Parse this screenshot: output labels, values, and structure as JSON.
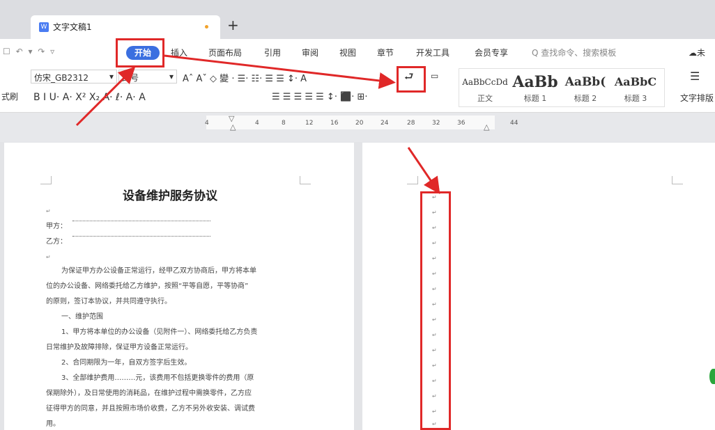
{
  "tabs": {
    "doc_title": "文字文稿1",
    "new_tab": "+"
  },
  "menu": {
    "quick_access": "☐ ↶ ▾ ↷ ▿",
    "items": [
      "开始",
      "插入",
      "页面布局",
      "引用",
      "审阅",
      "视图",
      "章节",
      "开发工具",
      "会员专享"
    ],
    "search": "查找命令、搜索模板",
    "cloud": "未"
  },
  "ribbon": {
    "format_painter": "式刷",
    "font": "仿宋_GB2312",
    "size": "四号",
    "row1_tools": "Aˆ Aˇ ◇ 變 ·  ☰· ☷· ☰ ☰ ↕· A",
    "row2_tools": "B  I  U·  A·  X²  X₂  A·  ℓ·  A·  A",
    "para_tools": "☰ ☰ ☰ ☰ ☰  ↕·  ⬛·  ⊞·",
    "paragraph_mark": "⮐",
    "styles": [
      {
        "preview": "AaBbCcDd",
        "label": "正文"
      },
      {
        "preview": "AaBb",
        "label": "标题 1"
      },
      {
        "preview": "AaBb(",
        "label": "标题 2"
      },
      {
        "preview": "AaBbC",
        "label": "标题 3"
      }
    ],
    "text_layout": "文字排版"
  },
  "ruler": {
    "ticks": [
      "4",
      "4",
      "8",
      "12",
      "16",
      "20",
      "24",
      "28",
      "32",
      "36",
      "44"
    ]
  },
  "document": {
    "heading": "设备维护服务协议",
    "party_a": "甲方：",
    "party_b": "乙方：",
    "lines": [
      "为保证甲方办公设备正常运行，经甲乙双方协商后，甲方将本单",
      "位的办公设备、网络委托给乙方维护，按照“平等自愿，平等协商”",
      "的原则，签订本协议，并共同遵守执行。",
      "一、维护范围",
      "1、甲方将本单位的办公设备（见附件一）、网络委托给乙方负责",
      "日常维护及故障排除，保证甲方设备正常运行。",
      "2、合同期限为一年，自双方签字后生效。",
      "3、全部维护费用………元，该费用不包括更换零件的费用（原",
      "保期除外），及日常使用的消耗品，在维护过程中需换零件，乙方应",
      "征得甲方的同意，并且按照市场价收费，乙方不另外收安装、调试费",
      "用。"
    ],
    "para_mark": "↵"
  }
}
